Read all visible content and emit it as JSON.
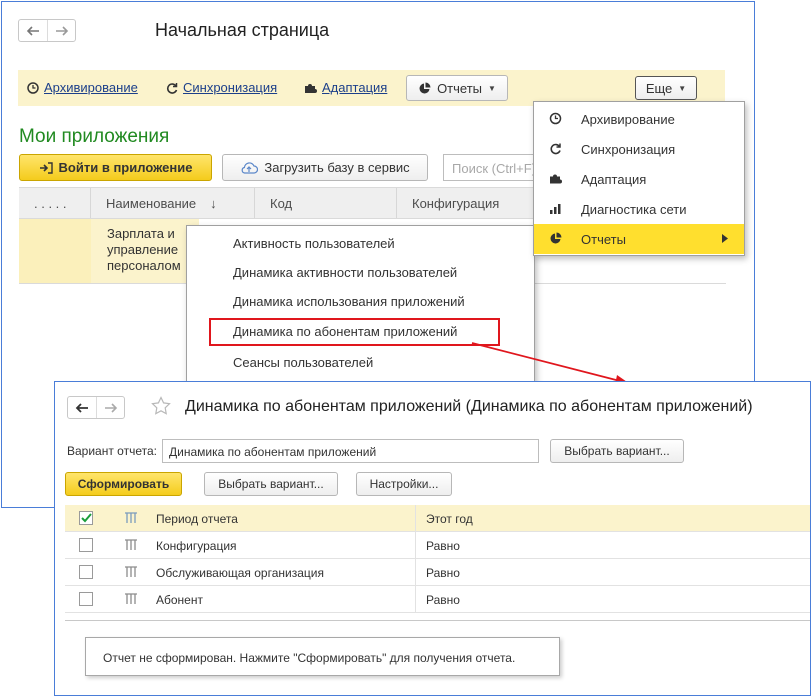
{
  "home": {
    "title": "Начальная страница",
    "toolbar": {
      "archiving": "Архивирование",
      "sync": "Синхронизация",
      "adaptation": "Адаптация",
      "reports_button": "Отчеты",
      "more_button": "Еще"
    },
    "my_apps_title": "Мои приложения",
    "login_button": "Войти в приложение",
    "upload_button": "Загрузить базу в сервис",
    "search_placeholder": "Поиск (Ctrl+F)",
    "table": {
      "col_dots": ". . . . .",
      "col_name": "Наименование",
      "col_code": "Код",
      "col_config": "Конфигурация",
      "row": {
        "line1": "Зарплата и",
        "line2": "управление",
        "line3": "персоналом"
      }
    },
    "reports_menu": [
      "Активность пользователей",
      "Динамика активности пользователей",
      "Динамика использования приложений",
      "Динамика по абонентам приложений",
      "Сеансы пользователей"
    ],
    "more_menu": [
      {
        "label": "Архивирование",
        "icon": "clock-icon"
      },
      {
        "label": "Синхронизация",
        "icon": "refresh-icon"
      },
      {
        "label": "Адаптация",
        "icon": "puzzle-icon"
      },
      {
        "label": "Диагностика сети",
        "icon": "signal-bars-icon"
      },
      {
        "label": "Отчеты",
        "icon": "pie-chart-icon"
      }
    ]
  },
  "report": {
    "title": "Динамика по абонентам приложений (Динамика по абонентам приложений)",
    "variant_label": "Вариант отчета:",
    "variant_value": "Динамика по абонентам приложений",
    "choose_variant_button": "Выбрать вариант...",
    "generate_button": "Сформировать",
    "choose_variant_button2": "Выбрать вариант...",
    "settings_button": "Настройки...",
    "filters": [
      {
        "name": "Период отчета",
        "value": "Этот год",
        "checked": true
      },
      {
        "name": "Конфигурация",
        "value": "Равно",
        "checked": false
      },
      {
        "name": "Обслуживающая организация",
        "value": "Равно",
        "checked": false
      },
      {
        "name": "Абонент",
        "value": "Равно",
        "checked": false
      }
    ],
    "message": "Отчет не сформирован. Нажмите \"Сформировать\" для получения отчета."
  },
  "colors": {
    "accent_yellow": "#ffdf2e",
    "highlight_red": "#e0161d",
    "title_green": "#218a21",
    "link_blue": "#1c3f8a",
    "window_border": "#4a7dd8"
  }
}
